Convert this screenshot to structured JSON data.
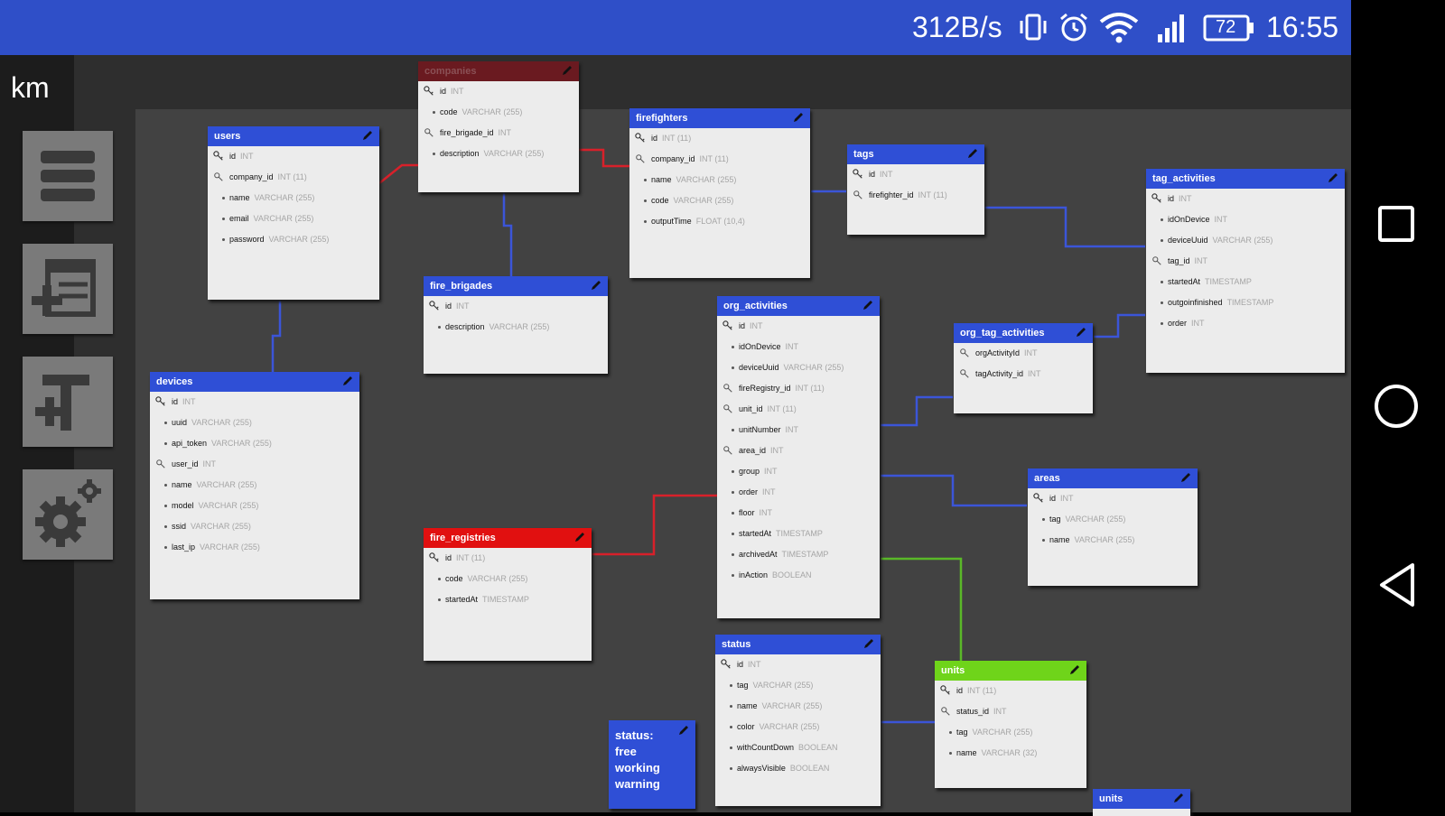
{
  "status_bar": {
    "net_speed": "312B/s",
    "battery": "72",
    "time": "16:55"
  },
  "app": {
    "name": "km"
  },
  "toolbar": {
    "items": [
      {
        "name": "menu"
      },
      {
        "name": "add-table"
      },
      {
        "name": "add-text"
      },
      {
        "name": "settings"
      }
    ]
  },
  "tables": [
    {
      "name": "users",
      "color": "blue",
      "fields": [
        {
          "name": "id",
          "type": "INT",
          "key": "pk"
        },
        {
          "name": "company_id",
          "type": "INT (11)",
          "key": "fk"
        },
        {
          "name": "name",
          "type": "VARCHAR (255)"
        },
        {
          "name": "email",
          "type": "VARCHAR (255)"
        },
        {
          "name": "password",
          "type": "VARCHAR (255)"
        }
      ]
    },
    {
      "name": "companies",
      "color": "maroon",
      "fields": [
        {
          "name": "id",
          "type": "INT",
          "key": "pk"
        },
        {
          "name": "code",
          "type": "VARCHAR (255)"
        },
        {
          "name": "fire_brigade_id",
          "type": "INT",
          "key": "fk"
        },
        {
          "name": "description",
          "type": "VARCHAR (255)"
        }
      ]
    },
    {
      "name": "firefighters",
      "color": "blue",
      "fields": [
        {
          "name": "id",
          "type": "INT (11)",
          "key": "pk"
        },
        {
          "name": "company_id",
          "type": "INT (11)",
          "key": "fk"
        },
        {
          "name": "name",
          "type": "VARCHAR (255)"
        },
        {
          "name": "code",
          "type": "VARCHAR (255)"
        },
        {
          "name": "outputTime",
          "type": "FLOAT (10,4)"
        }
      ]
    },
    {
      "name": "tags",
      "color": "blue",
      "fields": [
        {
          "name": "id",
          "type": "INT",
          "key": "pk"
        },
        {
          "name": "firefighter_id",
          "type": "INT (11)",
          "key": "fk"
        }
      ]
    },
    {
      "name": "tag_activities",
      "color": "blue",
      "fields": [
        {
          "name": "id",
          "type": "INT",
          "key": "pk"
        },
        {
          "name": "idOnDevice",
          "type": "INT"
        },
        {
          "name": "deviceUuid",
          "type": "VARCHAR (255)"
        },
        {
          "name": "tag_id",
          "type": "INT",
          "key": "fk"
        },
        {
          "name": "startedAt",
          "type": "TIMESTAMP"
        },
        {
          "name": "outgoinfinished",
          "type": "TIMESTAMP"
        },
        {
          "name": "order",
          "type": "INT"
        }
      ]
    },
    {
      "name": "fire_brigades",
      "color": "blue",
      "fields": [
        {
          "name": "id",
          "type": "INT",
          "key": "pk"
        },
        {
          "name": "description",
          "type": "VARCHAR (255)"
        }
      ]
    },
    {
      "name": "org_activities",
      "color": "blue",
      "fields": [
        {
          "name": "id",
          "type": "INT",
          "key": "pk"
        },
        {
          "name": "idOnDevice",
          "type": "INT"
        },
        {
          "name": "deviceUuid",
          "type": "VARCHAR (255)"
        },
        {
          "name": "fireRegistry_id",
          "type": "INT (11)",
          "key": "fk"
        },
        {
          "name": "unit_id",
          "type": "INT (11)",
          "key": "fk"
        },
        {
          "name": "unitNumber",
          "type": "INT"
        },
        {
          "name": "area_id",
          "type": "INT",
          "key": "fk"
        },
        {
          "name": "group",
          "type": "INT"
        },
        {
          "name": "order",
          "type": "INT"
        },
        {
          "name": "floor",
          "type": "INT"
        },
        {
          "name": "startedAt",
          "type": "TIMESTAMP"
        },
        {
          "name": "archivedAt",
          "type": "TIMESTAMP"
        },
        {
          "name": "inAction",
          "type": "BOOLEAN"
        }
      ]
    },
    {
      "name": "org_tag_activities",
      "color": "blue",
      "fields": [
        {
          "name": "orgActivityId",
          "type": "INT",
          "key": "fk"
        },
        {
          "name": "tagActivity_id",
          "type": "INT",
          "key": "fk"
        }
      ]
    },
    {
      "name": "devices",
      "color": "blue",
      "fields": [
        {
          "name": "id",
          "type": "INT",
          "key": "pk"
        },
        {
          "name": "uuid",
          "type": "VARCHAR (255)"
        },
        {
          "name": "api_token",
          "type": "VARCHAR (255)"
        },
        {
          "name": "user_id",
          "type": "INT",
          "key": "fk"
        },
        {
          "name": "name",
          "type": "VARCHAR (255)"
        },
        {
          "name": "model",
          "type": "VARCHAR (255)"
        },
        {
          "name": "ssid",
          "type": "VARCHAR (255)"
        },
        {
          "name": "last_ip",
          "type": "VARCHAR (255)"
        }
      ]
    },
    {
      "name": "areas",
      "color": "blue",
      "fields": [
        {
          "name": "id",
          "type": "INT",
          "key": "pk"
        },
        {
          "name": "tag",
          "type": "VARCHAR (255)"
        },
        {
          "name": "name",
          "type": "VARCHAR (255)"
        }
      ]
    },
    {
      "name": "fire_registries",
      "color": "red",
      "fields": [
        {
          "name": "id",
          "type": "INT (11)",
          "key": "pk"
        },
        {
          "name": "code",
          "type": "VARCHAR (255)"
        },
        {
          "name": "startedAt",
          "type": "TIMESTAMP"
        }
      ]
    },
    {
      "name": "status",
      "color": "blue",
      "fields": [
        {
          "name": "id",
          "type": "INT",
          "key": "pk"
        },
        {
          "name": "tag",
          "type": "VARCHAR (255)"
        },
        {
          "name": "name",
          "type": "VARCHAR (255)"
        },
        {
          "name": "color",
          "type": "VARCHAR (255)"
        },
        {
          "name": "withCountDown",
          "type": "BOOLEAN"
        },
        {
          "name": "alwaysVisible",
          "type": "BOOLEAN"
        }
      ]
    },
    {
      "name": "units",
      "color": "green",
      "fields": [
        {
          "name": "id",
          "type": "INT (11)",
          "key": "pk"
        },
        {
          "name": "status_id",
          "type": "INT",
          "key": "fk"
        },
        {
          "name": "tag",
          "type": "VARCHAR (255)"
        },
        {
          "name": "name",
          "type": "VARCHAR (32)"
        }
      ]
    },
    {
      "name": "units",
      "color": "blue",
      "fields": []
    }
  ],
  "notes": [
    {
      "text": "status:\nfree\nworking\nwarning"
    }
  ]
}
